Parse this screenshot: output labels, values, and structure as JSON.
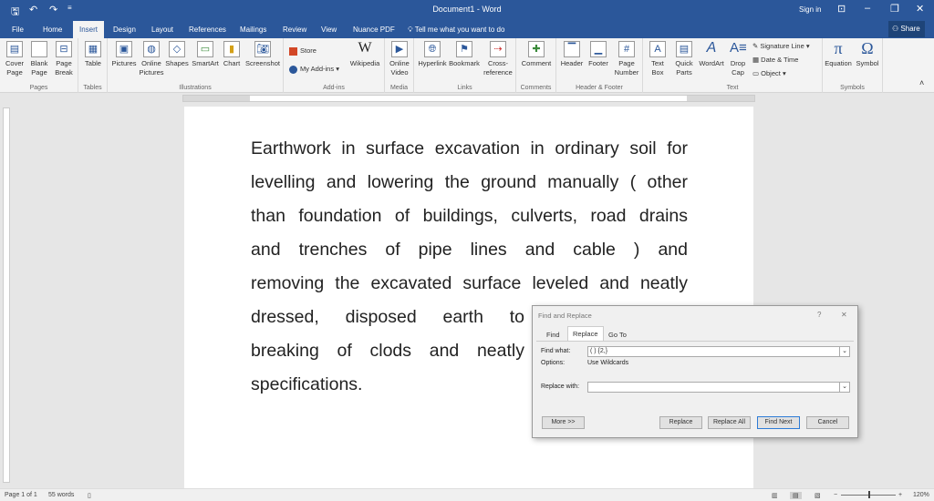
{
  "titlebar": {
    "title": "Document1 - Word",
    "sign_in": "Sign in",
    "quick_access": [
      "save-icon",
      "undo-icon",
      "redo-icon",
      "customize-icon"
    ]
  },
  "tabs": [
    "File",
    "Home",
    "Insert",
    "Design",
    "Layout",
    "References",
    "Mailings",
    "Review",
    "View",
    "Nuance PDF"
  ],
  "active_tab": "Insert",
  "tell_me": "Tell me what you want to do",
  "share": "Share",
  "ribbon": {
    "pages": {
      "label": "Pages",
      "items": [
        "Cover Page",
        "Blank Page",
        "Page Break"
      ]
    },
    "tables": {
      "label": "Tables",
      "items": [
        "Table"
      ]
    },
    "illustrations": {
      "label": "Illustrations",
      "items": [
        "Pictures",
        "Online Pictures",
        "Shapes",
        "SmartArt",
        "Chart",
        "Screenshot"
      ]
    },
    "addins": {
      "label": "Add-ins",
      "store": "Store",
      "my_addins": "My Add-ins",
      "wikipedia": "Wikipedia"
    },
    "media": {
      "label": "Media",
      "items": [
        "Online Video"
      ]
    },
    "links": {
      "label": "Links",
      "items": [
        "Hyperlink",
        "Bookmark",
        "Cross-reference"
      ]
    },
    "comments": {
      "label": "Comments",
      "items": [
        "Comment"
      ]
    },
    "header_footer": {
      "label": "Header & Footer",
      "items": [
        "Header",
        "Footer",
        "Page Number"
      ]
    },
    "text": {
      "label": "Text",
      "items": [
        "Text Box",
        "Quick Parts",
        "WordArt",
        "Drop Cap"
      ],
      "signature": "Signature Line",
      "datetime": "Date & Time",
      "object": "Object"
    },
    "symbols": {
      "label": "Symbols",
      "items": [
        "Equation",
        "Symbol"
      ]
    }
  },
  "document": {
    "lines": [
      "Earthwork in surface excavation in ordinary soil for",
      "levelling and lowering the ground manually ( other",
      "than foundation of buildings, culverts, road drains",
      "and trenches of pipe lines and cable ) and",
      "removing the excavated surface leveled and neatly",
      "dressed, disposed earth to",
      "breaking of clods and neatly",
      "specifications."
    ]
  },
  "status": {
    "page": "Page 1 of 1",
    "words": "55 words",
    "zoom": "120%",
    "zoom_percent": 120
  },
  "dialog": {
    "title": "Find and Replace",
    "help": "?",
    "close": "✕",
    "tabs": [
      "Find",
      "Replace",
      "Go To"
    ],
    "active_tab": "Replace",
    "find_label": "Find what:",
    "find_value": "( ) {2,}",
    "options_label": "Options:",
    "options_value": "Use Wildcards",
    "replace_label": "Replace with:",
    "replace_value": "",
    "buttons": {
      "more": "More >>",
      "replace": "Replace",
      "replace_all": "Replace All",
      "find_next": "Find Next",
      "cancel": "Cancel"
    }
  },
  "colors": {
    "brand": "#2b579a",
    "misspell_underline": "#7b4dd4"
  }
}
